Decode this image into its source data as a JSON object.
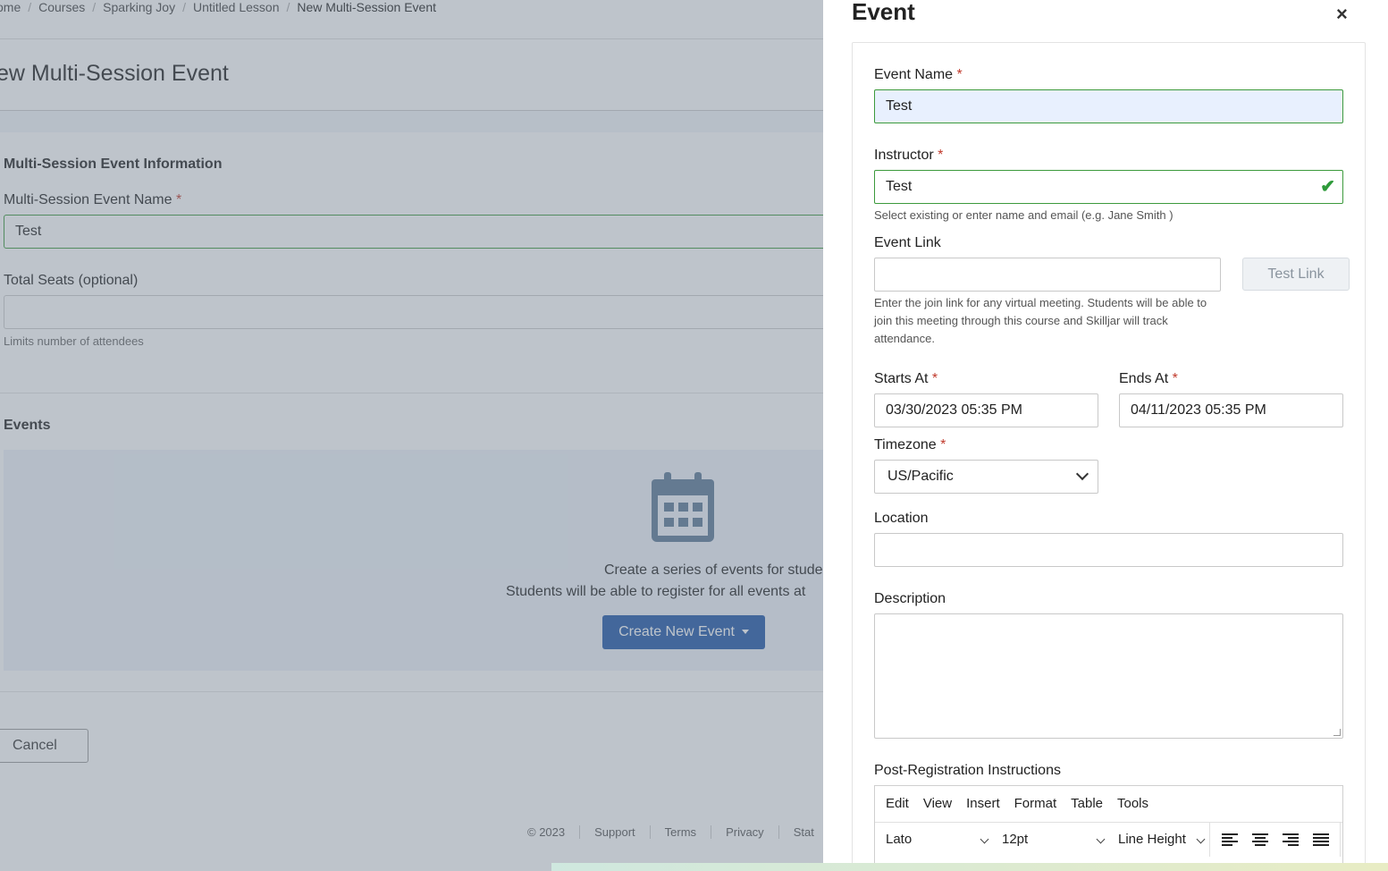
{
  "background": {
    "breadcrumb": [
      "ome",
      "Courses",
      "Sparking Joy",
      "Untitled Lesson",
      "New Multi-Session Event"
    ],
    "page_title": "ew Multi-Session Event",
    "info_heading": "Multi-Session Event Information",
    "name_label": "Multi-Session Event Name",
    "name_value": "Test",
    "seats_label": "Total Seats (optional)",
    "seats_help": "Limits number of attendees",
    "events_heading": "Events",
    "events_line1": "Create a series of events for students to tak",
    "events_line2": "Students will be able to register for all events at",
    "create_button": "Create New Event",
    "cancel_button": "Cancel",
    "footer": [
      "© 2023",
      "Support",
      "Terms",
      "Privacy",
      "Stat"
    ]
  },
  "drawer": {
    "title": "Event",
    "close": "×",
    "event_name_label": "Event Name",
    "event_name_value": "Test",
    "instructor_label": "Instructor",
    "instructor_value": "Test",
    "instructor_help": "Select existing or enter name and email (e.g. Jane Smith )",
    "event_link_label": "Event Link",
    "event_link_value": "",
    "test_link_button": "Test Link",
    "event_link_help": "Enter the join link for any virtual meeting. Students will be able to join this meeting through this course and Skilljar will track attendance.",
    "starts_label": "Starts At",
    "starts_value": "03/30/2023 05:35 PM",
    "ends_label": "Ends At",
    "ends_value": "04/11/2023 05:35 PM",
    "timezone_label": "Timezone",
    "timezone_value": "US/Pacific",
    "location_label": "Location",
    "location_value": "",
    "description_label": "Description",
    "post_reg_label": "Post-Registration Instructions",
    "editor_menu": [
      "Edit",
      "View",
      "Insert",
      "Format",
      "Table",
      "Tools"
    ],
    "font_family": "Lato",
    "font_size": "12pt",
    "line_height": "Line Height",
    "required_mark": "*"
  },
  "colors": {
    "primary_button": "#1f56a8",
    "valid_border": "#3c9a3c",
    "required": "#c0392b",
    "autofill_bg": "#e8f0fe"
  }
}
